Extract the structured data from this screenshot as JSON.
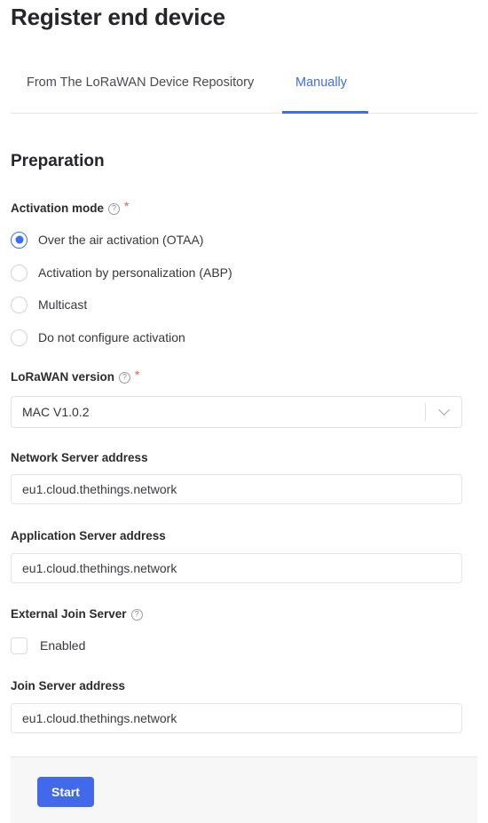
{
  "page": {
    "title": "Register end device"
  },
  "tabs": [
    {
      "label": "From The LoRaWAN Device Repository",
      "active": false
    },
    {
      "label": "Manually",
      "active": true
    }
  ],
  "preparation": {
    "heading": "Preparation",
    "activation_mode": {
      "label": "Activation mode",
      "required_marker": "*",
      "help_icon": "question-circle-icon",
      "options": [
        {
          "label": "Over the air activation (OTAA)",
          "selected": true
        },
        {
          "label": "Activation by personalization (ABP)",
          "selected": false
        },
        {
          "label": "Multicast",
          "selected": false
        },
        {
          "label": "Do not configure activation",
          "selected": false
        }
      ]
    },
    "lorawan_version": {
      "label": "LoRaWAN version",
      "required_marker": "*",
      "help_icon": "question-circle-icon",
      "value": "MAC V1.0.2",
      "dropdown_icon": "chevron-down-icon"
    },
    "network_server_address": {
      "label": "Network Server address",
      "value": "eu1.cloud.thethings.network",
      "placeholder": ""
    },
    "application_server_address": {
      "label": "Application Server address",
      "value": "eu1.cloud.thethings.network",
      "placeholder": ""
    },
    "external_join_server": {
      "label": "External Join Server",
      "help_icon": "question-circle-icon",
      "checkbox_label": "Enabled",
      "checked": false
    },
    "join_server_address": {
      "label": "Join Server address",
      "value": "eu1.cloud.thethings.network",
      "placeholder": ""
    }
  },
  "footer": {
    "start_label": "Start"
  },
  "colors": {
    "accent_blue": "#3a6df0",
    "button_blue": "#4169ea",
    "required_red": "#f5564a",
    "footer_bg": "#f7f7f8",
    "border": "#e6e6e8"
  }
}
